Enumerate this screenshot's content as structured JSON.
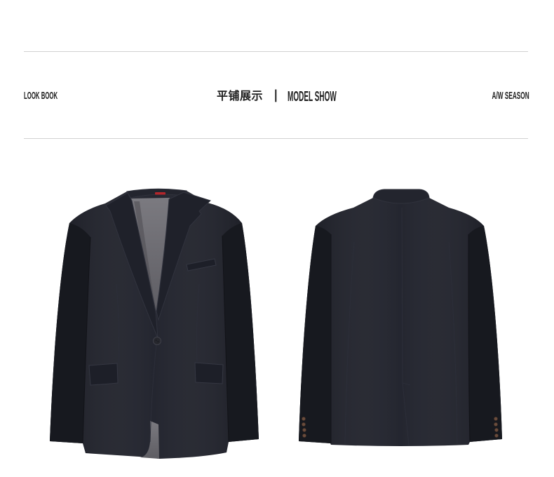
{
  "header": {
    "left_label": "LOOK BOOK",
    "title_cn": "平铺展示",
    "separator": "|",
    "title_en": "MODEL SHOW",
    "right_label": "A/W SEASON"
  },
  "gallery": {
    "items": [
      {
        "icon": "suit-jacket-front-image"
      },
      {
        "icon": "suit-jacket-back-image"
      }
    ]
  },
  "colors": {
    "rule": "#d2d2d2",
    "text": "#1e1e1e",
    "jacket": "#1c1e28",
    "lining": "#7b7a80",
    "label": "#b3262b",
    "cuffbtn": "#6a4c3c"
  }
}
